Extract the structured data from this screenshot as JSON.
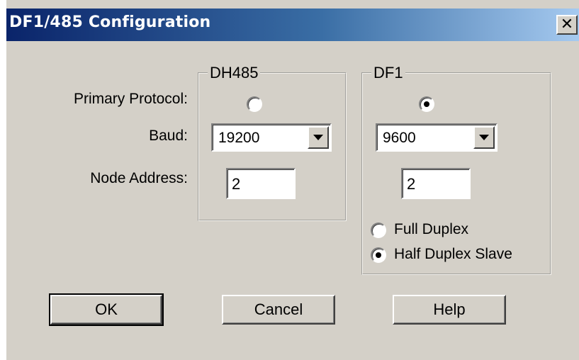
{
  "window": {
    "title": "DF1/485 Configuration",
    "close_label": "✕"
  },
  "labels": {
    "primary_protocol": "Primary Protocol:",
    "baud": "Baud:",
    "node_address": "Node Address:"
  },
  "dh485": {
    "legend": "DH485",
    "protocol_selected": false,
    "baud": "19200",
    "node_address": "2"
  },
  "df1": {
    "legend": "DF1",
    "protocol_selected": true,
    "baud": "9600",
    "node_address": "2",
    "duplex_options": [
      {
        "label": "Full Duplex",
        "selected": false
      },
      {
        "label": "Half Duplex Slave",
        "selected": true
      }
    ]
  },
  "buttons": {
    "ok": "OK",
    "cancel": "Cancel",
    "help": "Help"
  }
}
